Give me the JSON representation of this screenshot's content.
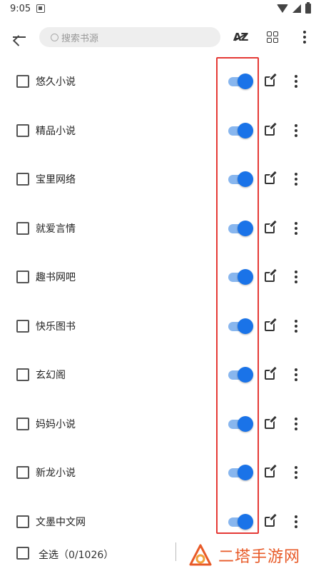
{
  "status_bar": {
    "time": "9:05"
  },
  "toolbar": {
    "search_placeholder": "搜索书源",
    "sort_label": "AZ"
  },
  "sources": [
    {
      "name": "悠久小说",
      "enabled": true,
      "checked": false
    },
    {
      "name": "精品小说",
      "enabled": true,
      "checked": false
    },
    {
      "name": "宝里网络",
      "enabled": true,
      "checked": false
    },
    {
      "name": "就爱言情",
      "enabled": true,
      "checked": false
    },
    {
      "name": "趣书网吧",
      "enabled": true,
      "checked": false
    },
    {
      "name": "快乐图书",
      "enabled": true,
      "checked": false
    },
    {
      "name": "玄幻阁",
      "enabled": true,
      "checked": false
    },
    {
      "name": "妈妈小说",
      "enabled": true,
      "checked": false
    },
    {
      "name": "新龙小说",
      "enabled": true,
      "checked": false
    },
    {
      "name": "文墨中文网",
      "enabled": true,
      "checked": false
    }
  ],
  "bottom_bar": {
    "select_all_label": "全选",
    "count": "（0/1026）"
  },
  "watermark": {
    "text": "二塔手游网"
  },
  "colors": {
    "switch_on": "#1a73e8",
    "switch_track": "#88b6ee",
    "highlight": "#e53935",
    "watermark": "#e85a28"
  }
}
